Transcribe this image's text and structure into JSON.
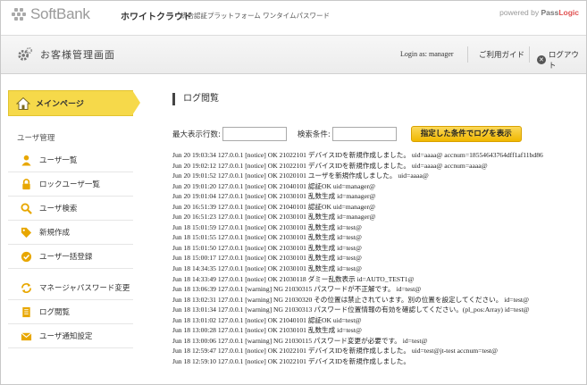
{
  "header": {
    "logo_text": "SoftBank",
    "product_name": "ホワイトクラウド",
    "product_subtitle": "統合認証プラットフォーム ワンタイムパスワード",
    "powered_prefix": "powered by",
    "powered_brand_a": "Pass",
    "powered_brand_b": "Logic",
    "admin_title": "お客様管理画面",
    "login_as": "Login as: manager",
    "guide_label": "ご利用ガイド",
    "logout_label": "ログアウト"
  },
  "sidebar": {
    "main_item": "メインページ",
    "section_label": "ユーザ管理",
    "items": [
      {
        "label": "ユーザ一覧",
        "icon": "user-icon"
      },
      {
        "label": "ロックユーザ一覧",
        "icon": "lock-icon"
      },
      {
        "label": "ユーザ検索",
        "icon": "search-icon"
      },
      {
        "label": "新規作成",
        "icon": "tag-icon"
      },
      {
        "label": "ユーザ一括登録",
        "icon": "check-circle-icon"
      },
      {
        "label": "マネージャパスワード変更",
        "icon": "refresh-icon"
      },
      {
        "label": "ログ閲覧",
        "icon": "document-icon"
      },
      {
        "label": "ユーザ通知設定",
        "icon": "mail-icon"
      }
    ]
  },
  "main": {
    "title": "ログ閲覧",
    "max_rows_label": "最大表示行数:",
    "max_rows_value": "",
    "search_label": "検索条件:",
    "search_value": "",
    "show_button": "指定した条件でログを表示",
    "log_lines": [
      "Jun 20 19:03:34 127.0.0.1 [notice] OK 21022101 デバイスIDを新規作成しました。 uid=aaaa@          accnum=18554643764dff1af11bd86",
      "Jun 20 19:02:12 127.0.0.1 [notice] OK 21022101 デバイスIDを新規作成しました。 uid=aaaa@          accnum=aaaa@",
      "Jun 20 19:01:52 127.0.0.1 [notice] OK 21020101 ユーザを新規作成しました。 uid=aaaa@",
      "Jun 20 19:01:20 127.0.0.1 [notice] OK 21040101 認証OK uid=manager@",
      "Jun 20 19:01:04 127.0.0.1 [notice] OK 21030101 乱数生成 id=manager@",
      "Jun 20 16:51:39 127.0.0.1 [notice] OK 21040101 認証OK uid=manager@",
      "Jun 20 16:51:23 127.0.0.1 [notice] OK 21030101 乱数生成 id=manager@",
      "Jun 18 15:01:59 127.0.0.1 [notice] OK 21030101 乱数生成 id=test@",
      "Jun 18 15:01:55 127.0.0.1 [notice] OK 21030101 乱数生成 id=test@",
      "Jun 18 15:01:50 127.0.0.1 [notice] OK 21030101 乱数生成 id=test@",
      "Jun 18 15:00:17 127.0.0.1 [notice] OK 21030101 乱数生成 id=test@",
      "Jun 18 14:34:35 127.0.0.1 [notice] OK 21030101 乱数生成 id=test@",
      "Jun 18 14:33:49 127.0.0.1 [notice] OK 21030118 ダミー乱数表示 id=AUTO_TEST1@",
      "Jun 18 13:06:39 127.0.0.1 [warning] NG 21030315 パスワードが不正解です。 id=test@",
      "Jun 18 13:02:31 127.0.0.1 [warning] NG 21030320 その位置は禁止されています。別の位置を設定してください。 id=test@",
      "Jun 18 13:01:34 127.0.0.1 [warning] NG 21030313 パスワード位置情報の有効を確認してください。(pl_pos:Array) id=test@",
      "Jun 18 13:01:02 127.0.0.1 [notice] OK 21040101 認証OK uid=test@",
      "Jun 18 13:00:28 127.0.0.1 [notice] OK 21030101 乱数生成 id=test@",
      "Jun 18 13:00:06 127.0.0.1 [warning] NG 21030115 パスワード変更が必要です。 id=test@",
      "Jun 18 12:59:47 127.0.0.1 [notice] OK 21022101 デバイスIDを新規作成しました。 uid=test@jt-test accnum=test@",
      "Jun 18 12:59:10 127.0.0.1 [notice] OK 21022101 デバイスIDを新規作成しました。"
    ]
  },
  "colors": {
    "accent_yellow": "#f6d94a",
    "button_yellow": "#f0b800",
    "icon_orange": "#e8a700"
  }
}
